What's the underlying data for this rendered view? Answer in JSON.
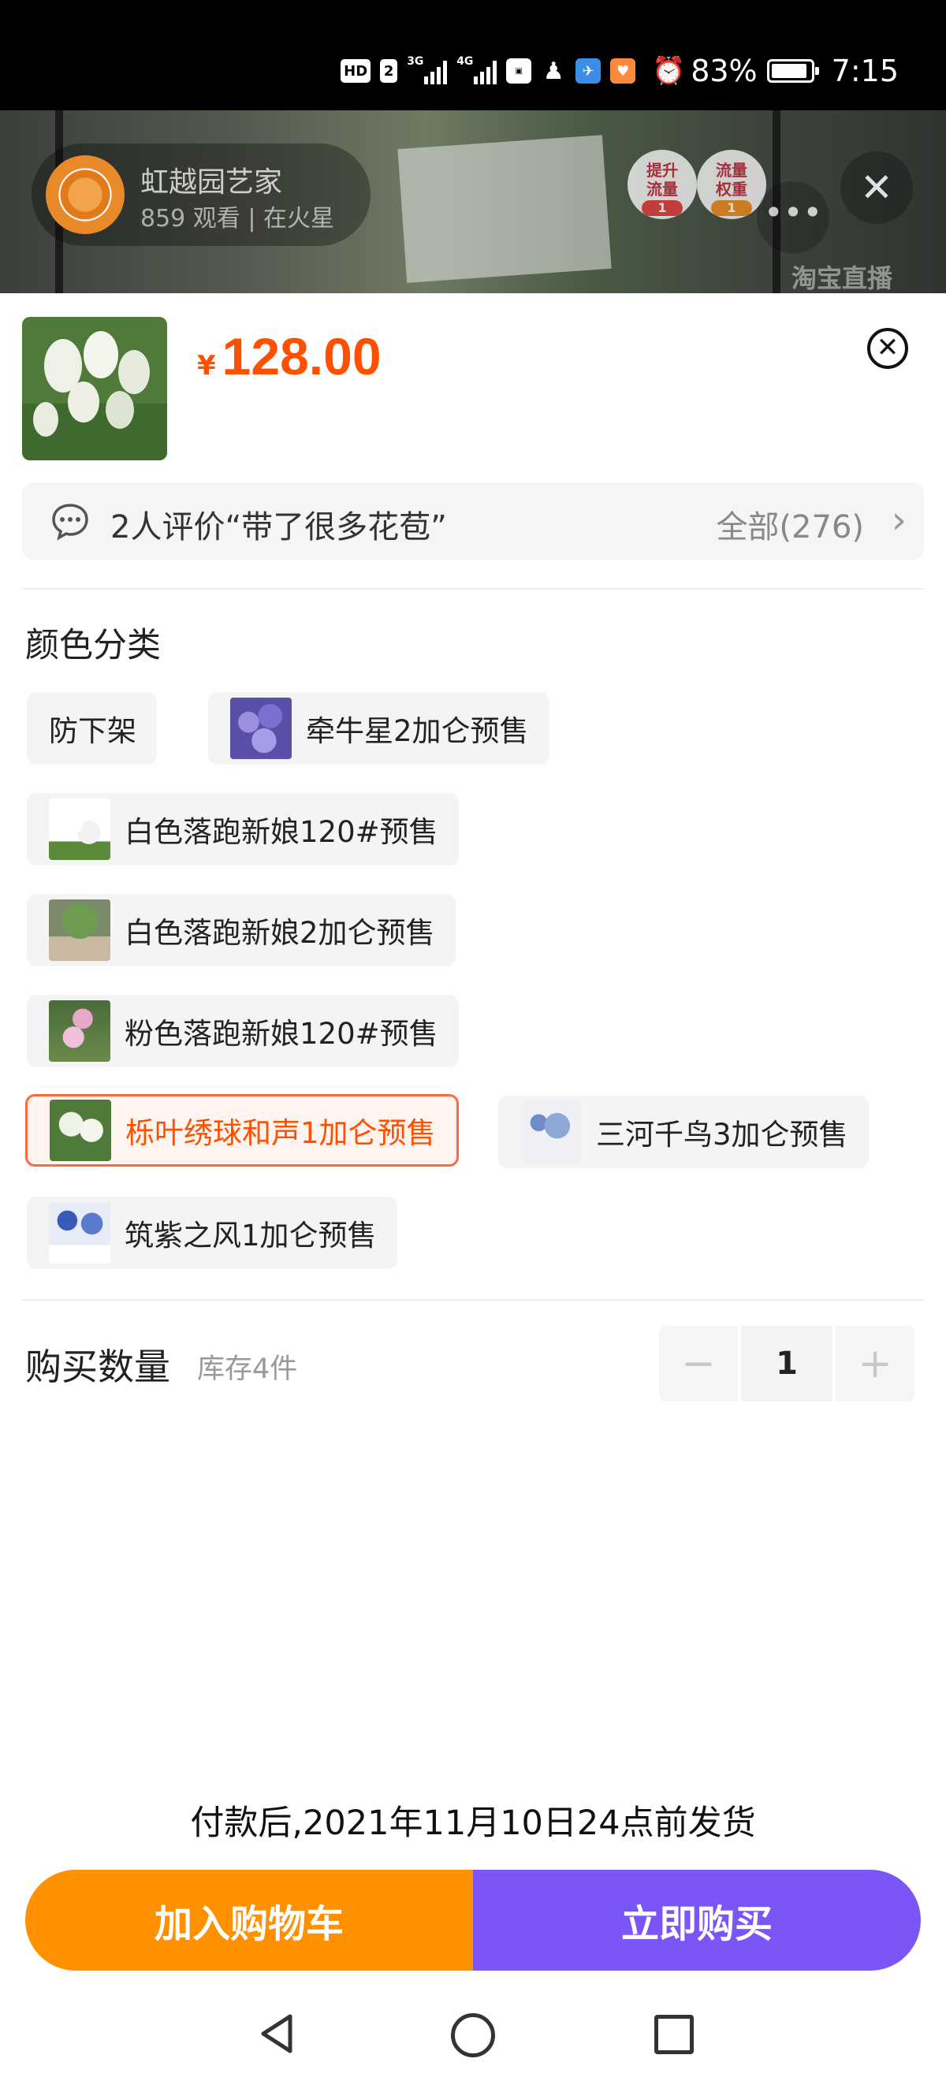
{
  "status_bar": {
    "hd_label": "HD",
    "sim_label": "2",
    "net1_label": "3G",
    "net2_label": "4G",
    "battery_percent": 83,
    "battery_text": "83%",
    "time": "7:15"
  },
  "live": {
    "host_name": "虹越园艺家",
    "host_sub": "859 观看 | 在火星",
    "badge1_text": "提升流量",
    "badge1_count": "1",
    "badge2_text": "流量权重",
    "badge2_count": "1",
    "more_label": "•••",
    "close_label": "✕",
    "brand": "淘宝直播"
  },
  "product": {
    "currency": "¥",
    "price": "128.00",
    "close_label": "✕"
  },
  "review": {
    "text": "2人评价“带了很多花苞”",
    "all_label": "全部(276)",
    "arrow": "›"
  },
  "variants": {
    "title": "颜色分类",
    "options": [
      {
        "label": "防下架",
        "selected": false
      },
      {
        "label": "牵牛星2加仑预售",
        "selected": false
      },
      {
        "label": "白色落跑新娘120#预售",
        "selected": false
      },
      {
        "label": "白色落跑新娘2加仑预售",
        "selected": false
      },
      {
        "label": "粉色落跑新娘120#预售",
        "selected": false
      },
      {
        "label": "栎叶绣球和声1加仑预售",
        "selected": true
      },
      {
        "label": "三河千鸟3加仑预售",
        "selected": false
      },
      {
        "label": "筑紫之风1加仑预售",
        "selected": false
      }
    ]
  },
  "quantity": {
    "label": "购买数量",
    "stock": "库存4件",
    "minus": "−",
    "value": "1",
    "plus": "+"
  },
  "shipping_note": "付款后,2021年11月10日24点前发货",
  "actions": {
    "add_to_cart": "加入购物车",
    "buy_now": "立即购买"
  },
  "colors": {
    "price": "#ff5000",
    "cart_button": "#ff9000",
    "buy_button": "#7b55f6",
    "selected_border": "#ff6a3d"
  },
  "icons": {
    "review": "chat-bubble-icon",
    "sheet_close": "circle-x-icon",
    "nav_back": "triangle-back-icon",
    "nav_home": "circle-home-icon",
    "nav_recent": "square-recent-icon"
  }
}
